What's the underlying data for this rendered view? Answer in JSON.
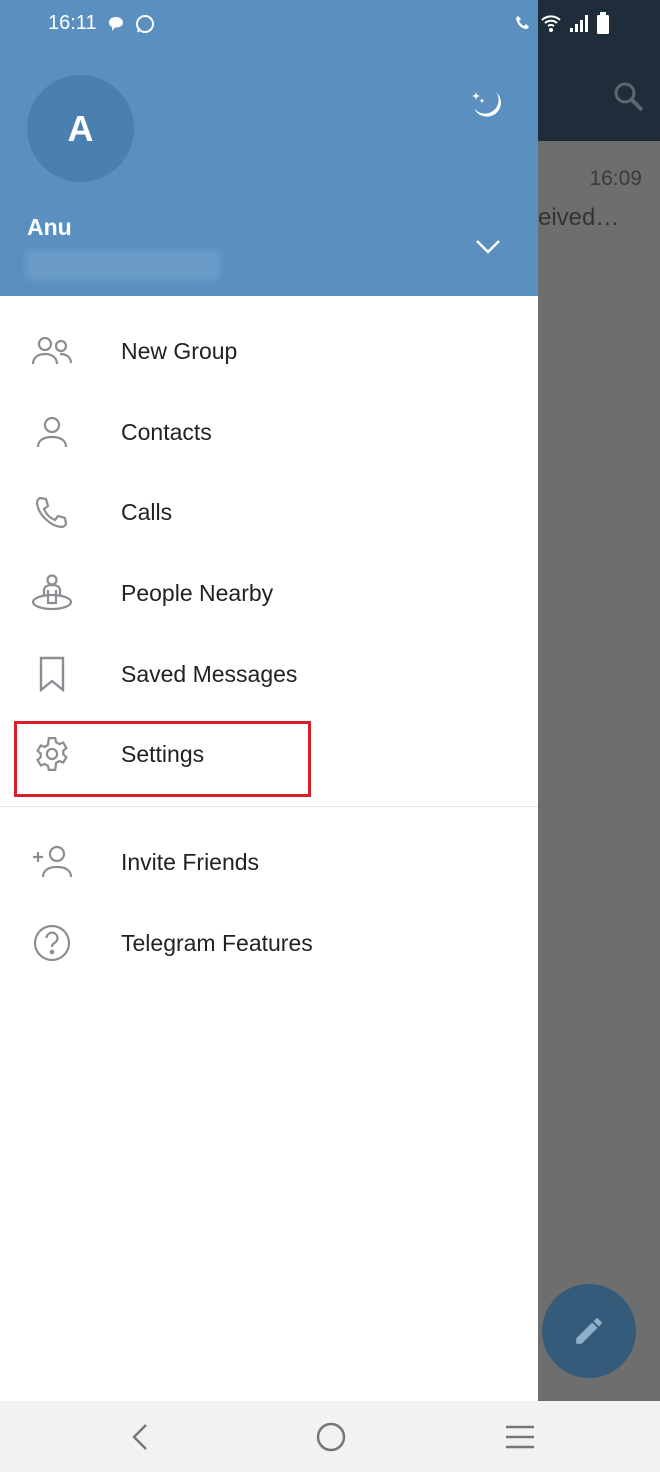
{
  "status_bar": {
    "time": "16:11",
    "icons": [
      "chat-bubble-icon",
      "whatsapp-icon",
      "wifi-call-icon",
      "wifi-icon",
      "signal-icon",
      "battery-icon"
    ]
  },
  "background": {
    "chat_time": "16:09",
    "chat_snippet": "eived…"
  },
  "profile": {
    "avatar_letter": "A",
    "name": "Anu"
  },
  "menu": [
    {
      "label": "New Group",
      "icon": "group-icon"
    },
    {
      "label": "Contacts",
      "icon": "person-icon"
    },
    {
      "label": "Calls",
      "icon": "phone-icon"
    },
    {
      "label": "People Nearby",
      "icon": "people-nearby-icon"
    },
    {
      "label": "Saved Messages",
      "icon": "bookmark-icon"
    },
    {
      "label": "Settings",
      "icon": "gear-icon"
    },
    {
      "label": "Invite Friends",
      "icon": "add-person-icon"
    },
    {
      "label": "Telegram Features",
      "icon": "question-icon"
    }
  ],
  "colors": {
    "header": "#5a8fbf",
    "highlight": "#d6202a",
    "icon": "#8a8e93"
  }
}
